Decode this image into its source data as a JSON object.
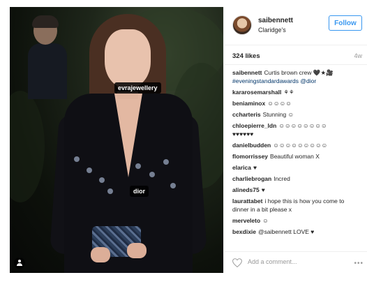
{
  "post": {
    "tags": {
      "evra": "evrajewellery",
      "dior": "dior"
    }
  },
  "header": {
    "username": "saibennett",
    "location": "Claridge's",
    "follow_label": "Follow"
  },
  "stats": {
    "likes": "324 likes",
    "age": "4w"
  },
  "caption": {
    "user": "saibennett",
    "text": "Curtis brown crew 🖤★🎥",
    "hashtag": "#eveningstandardawards",
    "mention": "@dior"
  },
  "comments": [
    {
      "user": "kararosemarshall",
      "text": "⚘⚘"
    },
    {
      "user": "beniaminox",
      "text": "☺☺☺☺"
    },
    {
      "user": "ccharteris",
      "text": "Stunning ☺"
    },
    {
      "user": "chloepierre_ldn",
      "text": "☺☺☺☺☺☺☺☺"
    },
    {
      "user": "",
      "text": "♥♥♥♥♥♥"
    },
    {
      "user": "danielbudden",
      "text": "☺☺☺☺☺☺☺☺☺"
    },
    {
      "user": "flomorrissey",
      "text": "Beautiful woman X"
    },
    {
      "user": "elarica",
      "text": "♥"
    },
    {
      "user": "charliebrogan",
      "text": "Incred"
    },
    {
      "user": "alineds75",
      "text": "♥"
    },
    {
      "user": "laurattabet",
      "text": "i hope this is how you come to"
    },
    {
      "user": "",
      "text": "dinner in a bit please x"
    },
    {
      "user": "merveleto",
      "text": "☺"
    },
    {
      "user": "bexdixie",
      "text": "@saibennett LOVE ♥"
    }
  ],
  "footer": {
    "add_comment_placeholder": "Add a comment...",
    "more_label": "•••"
  }
}
